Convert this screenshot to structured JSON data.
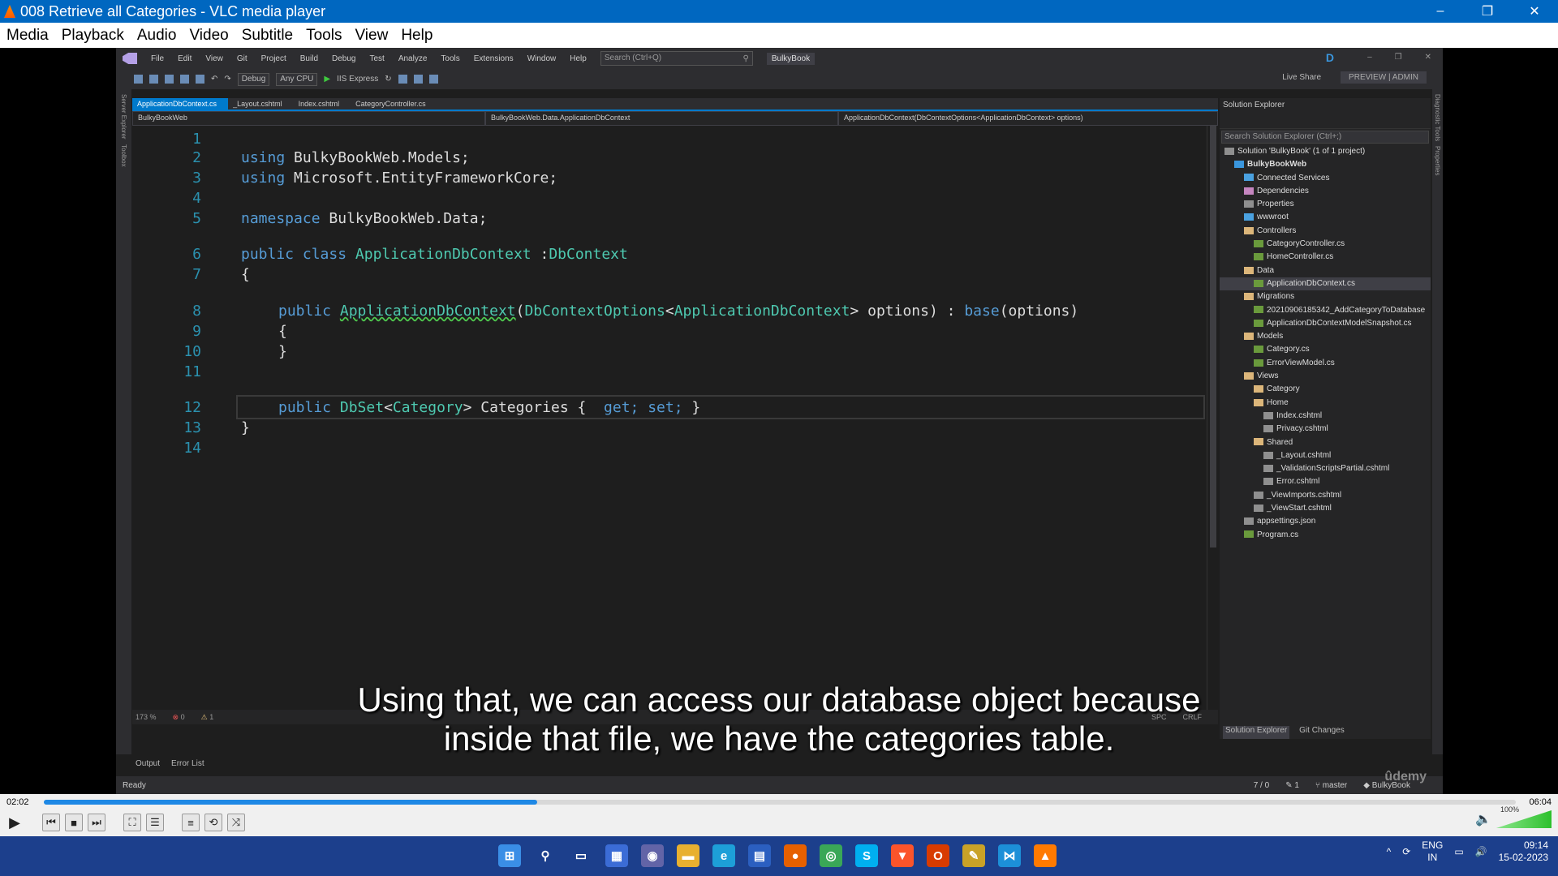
{
  "window": {
    "title": "008 Retrieve all Categories - VLC media player",
    "controls": [
      "–",
      "❐",
      "✕"
    ]
  },
  "menubar": [
    "Media",
    "Playback",
    "Audio",
    "Video",
    "Subtitle",
    "Tools",
    "View",
    "Help"
  ],
  "vs": {
    "menu": [
      "File",
      "Edit",
      "View",
      "Git",
      "Project",
      "Build",
      "Debug",
      "Test",
      "Analyze",
      "Tools",
      "Extensions",
      "Window",
      "Help"
    ],
    "search_placeholder": "Search (Ctrl+Q)",
    "solution_badge": "BulkyBook",
    "user_initial": "D",
    "toolbar": {
      "config": "Debug",
      "platform": "Any CPU",
      "run_target": "IIS Express",
      "live_share": "Live Share",
      "preview": "PREVIEW | ADMIN"
    },
    "left_strip": [
      "Server Explorer",
      "Toolbox"
    ],
    "right_strip": [
      "Diagnostic Tools",
      "Properties"
    ],
    "tabs": [
      {
        "label": "ApplicationDbContext.cs",
        "active": true
      },
      {
        "label": "_Layout.cshtml",
        "active": false
      },
      {
        "label": "Index.cshtml",
        "active": false
      },
      {
        "label": "CategoryController.cs",
        "active": false
      }
    ],
    "nav": {
      "project": "BulkyBookWeb",
      "class": "BulkyBookWeb.Data.ApplicationDbContext",
      "member": "ApplicationDbContext(DbContextOptions<ApplicationDbContext> options)"
    },
    "code": {
      "l2": [
        "using",
        "BulkyBookWeb.Models;"
      ],
      "l3": [
        "using",
        "Microsoft.EntityFrameworkCore;"
      ],
      "l5": [
        "namespace",
        "BulkyBookWeb.Data;"
      ],
      "l6": [
        "public class",
        "ApplicationDbContext",
        ":",
        "DbContext"
      ],
      "l7": "{",
      "l8": [
        "public",
        "ApplicationDbContext",
        "(",
        "DbContextOptions",
        "<",
        "ApplicationDbContext",
        "> options) :",
        "base",
        "(options)"
      ],
      "l9": "{",
      "l10": "}",
      "l12": [
        "public",
        "DbSet",
        "<",
        "Category",
        "> Categories {",
        "get;",
        "set;",
        "}"
      ],
      "l13": "}"
    },
    "line_numbers": [
      "1",
      "2",
      "3",
      "4",
      "5",
      "6",
      "7",
      "8",
      "9",
      "10",
      "11",
      "12",
      "13",
      "14"
    ],
    "editor_status": {
      "zoom": "173 %",
      "errors": "0",
      "warnings": "1",
      "spc": "SPC",
      "crlf": "CRLF"
    },
    "output_tabs": [
      "Output",
      "Error List"
    ],
    "solution_explorer": {
      "title": "Solution Explorer",
      "search": "Search Solution Explorer (Ctrl+;)",
      "items": [
        {
          "label": "Solution 'BulkyBook' (1 of 1 project)",
          "depth": 0,
          "icon": "solution"
        },
        {
          "label": "BulkyBookWeb",
          "depth": 1,
          "icon": "proj",
          "bold": true
        },
        {
          "label": "Connected Services",
          "depth": 2,
          "icon": "web"
        },
        {
          "label": "Dependencies",
          "depth": 2,
          "icon": "dep"
        },
        {
          "label": "Properties",
          "depth": 2,
          "icon": "page"
        },
        {
          "label": "wwwroot",
          "depth": 2,
          "icon": "web"
        },
        {
          "label": "Controllers",
          "depth": 2,
          "icon": "folder"
        },
        {
          "label": "CategoryController.cs",
          "depth": 3,
          "icon": "cs"
        },
        {
          "label": "HomeController.cs",
          "depth": 3,
          "icon": "cs"
        },
        {
          "label": "Data",
          "depth": 2,
          "icon": "folder"
        },
        {
          "label": "ApplicationDbContext.cs",
          "depth": 3,
          "icon": "cs",
          "selected": true
        },
        {
          "label": "Migrations",
          "depth": 2,
          "icon": "folder"
        },
        {
          "label": "20210906185342_AddCategoryToDatabase",
          "depth": 3,
          "icon": "cs"
        },
        {
          "label": "ApplicationDbContextModelSnapshot.cs",
          "depth": 3,
          "icon": "cs"
        },
        {
          "label": "Models",
          "depth": 2,
          "icon": "folder"
        },
        {
          "label": "Category.cs",
          "depth": 3,
          "icon": "cs"
        },
        {
          "label": "ErrorViewModel.cs",
          "depth": 3,
          "icon": "cs"
        },
        {
          "label": "Views",
          "depth": 2,
          "icon": "folder"
        },
        {
          "label": "Category",
          "depth": 3,
          "icon": "folder"
        },
        {
          "label": "Home",
          "depth": 3,
          "icon": "folder"
        },
        {
          "label": "Index.cshtml",
          "depth": 4,
          "icon": "page"
        },
        {
          "label": "Privacy.cshtml",
          "depth": 4,
          "icon": "page"
        },
        {
          "label": "Shared",
          "depth": 3,
          "icon": "folder"
        },
        {
          "label": "_Layout.cshtml",
          "depth": 4,
          "icon": "page"
        },
        {
          "label": "_ValidationScriptsPartial.cshtml",
          "depth": 4,
          "icon": "page"
        },
        {
          "label": "Error.cshtml",
          "depth": 4,
          "icon": "page"
        },
        {
          "label": "_ViewImports.cshtml",
          "depth": 3,
          "icon": "page"
        },
        {
          "label": "_ViewStart.cshtml",
          "depth": 3,
          "icon": "page"
        },
        {
          "label": "appsettings.json",
          "depth": 2,
          "icon": "page"
        },
        {
          "label": "Program.cs",
          "depth": 2,
          "icon": "cs"
        }
      ],
      "bottom_tabs": [
        "Solution Explorer",
        "Git Changes"
      ]
    },
    "statusbar": {
      "ready": "Ready",
      "lines": "7 / 0",
      "edits": "1",
      "branch": "master",
      "repo": "BulkyBook"
    },
    "watermark": "ûdemy"
  },
  "subtitle": {
    "line1": "Using that, we can access our database object because",
    "line2": "inside that file, we have the categories table."
  },
  "player": {
    "elapsed": "02:02",
    "total": "06:04",
    "progress": 0.335,
    "volume_label": "100%",
    "volume": 1.0
  },
  "taskbar": {
    "apps": [
      {
        "name": "start-icon",
        "glyph": "⊞",
        "color": "#3a8ee6"
      },
      {
        "name": "search-icon",
        "glyph": "⚲",
        "color": "transparent"
      },
      {
        "name": "task-view-icon",
        "glyph": "▭",
        "color": "transparent"
      },
      {
        "name": "widgets-icon",
        "glyph": "▦",
        "color": "#3b6cd6"
      },
      {
        "name": "teams-chat-icon",
        "glyph": "◉",
        "color": "#6264a7"
      },
      {
        "name": "file-explorer-icon",
        "glyph": "▬",
        "color": "#e8b030"
      },
      {
        "name": "edge-icon",
        "glyph": "e",
        "color": "#1d9fd8"
      },
      {
        "name": "store-icon",
        "glyph": "▤",
        "color": "#2b5fc0"
      },
      {
        "name": "firefox-icon",
        "glyph": "●",
        "color": "#e66000"
      },
      {
        "name": "chrome-icon",
        "glyph": "◎",
        "color": "#3aa757"
      },
      {
        "name": "skype-icon",
        "glyph": "S",
        "color": "#00aff0"
      },
      {
        "name": "brave-icon",
        "glyph": "▼",
        "color": "#fb542b"
      },
      {
        "name": "office-icon",
        "glyph": "O",
        "color": "#d83b01"
      },
      {
        "name": "paint-icon",
        "glyph": "✎",
        "color": "#c9a227"
      },
      {
        "name": "vs-taskbar-icon",
        "glyph": "⋈",
        "color": "#1c8fd8"
      },
      {
        "name": "vlc-taskbar-icon",
        "glyph": "▲",
        "color": "#ff7a00"
      }
    ],
    "lang_top": "ENG",
    "lang_bottom": "IN",
    "time": "09:14",
    "date": "15-02-2023"
  }
}
